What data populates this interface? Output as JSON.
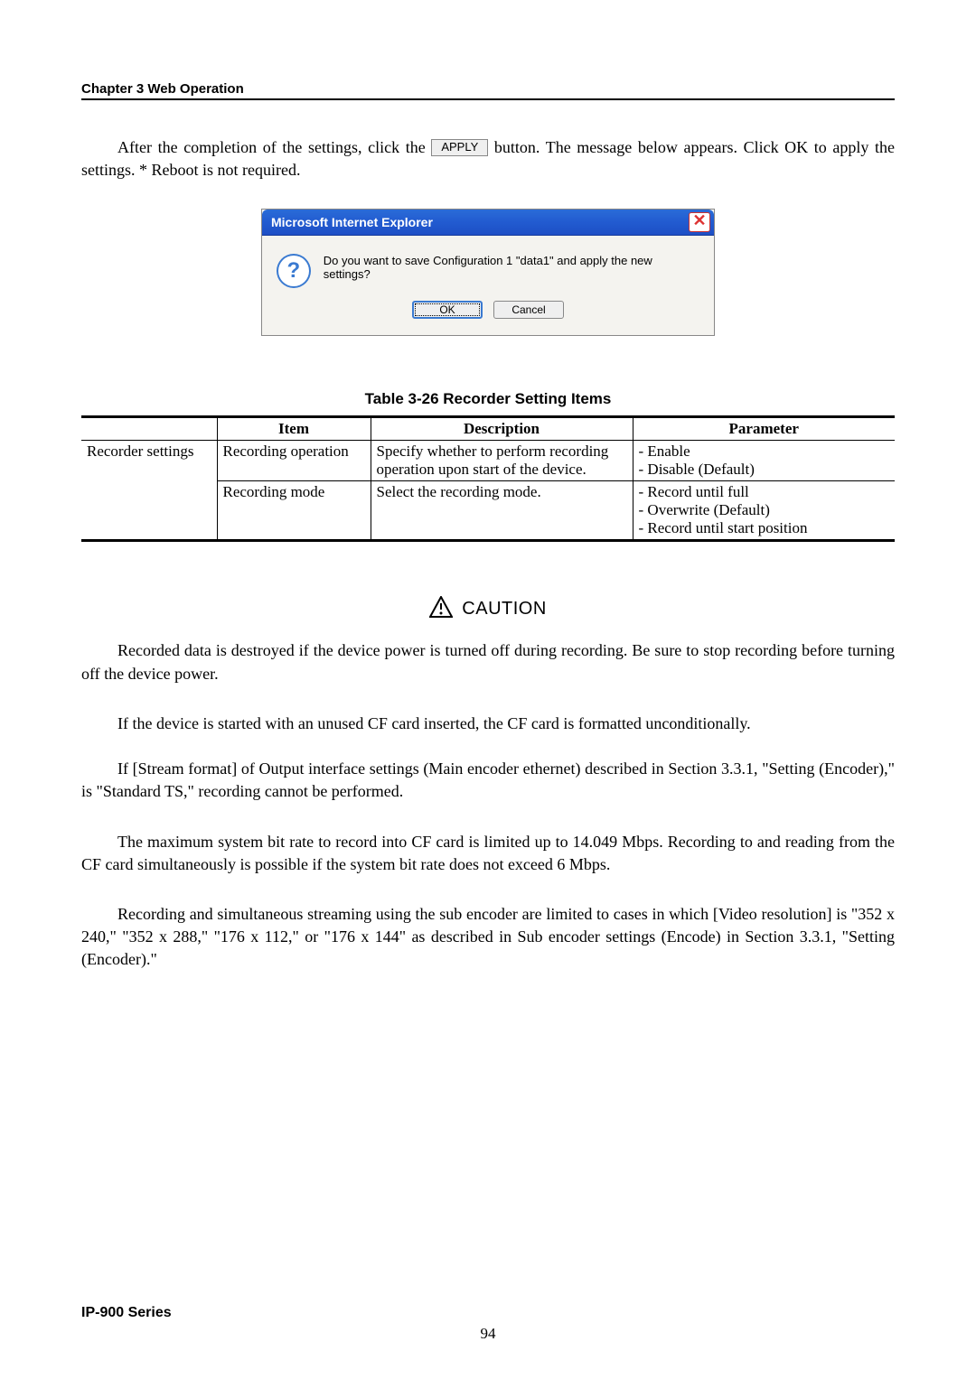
{
  "header": {
    "chapter": "Chapter 3  Web Operation"
  },
  "intro": {
    "before_btn": "After the completion of the settings, click the ",
    "apply_label": "APPLY",
    "after_btn": " button.  The message below appears.  Click OK to apply the settings. * Reboot is not required."
  },
  "dialog": {
    "title": "Microsoft Internet Explorer",
    "close_glyph": "✕",
    "question_glyph": "?",
    "message": "Do you want to save Configuration 1 \"data1\" and apply the new settings?",
    "ok": "OK",
    "cancel": "Cancel"
  },
  "table": {
    "caption": "Table 3-26  Recorder Setting Items",
    "headers": {
      "c1": "",
      "c2": "Item",
      "c3": "Description",
      "c4": "Parameter"
    },
    "group": "Recorder settings",
    "row1": {
      "item": "Recording operation",
      "desc": "Specify whether to perform recording operation upon start of the device.",
      "p1": "- Enable",
      "p2": "- Disable (Default)"
    },
    "row2": {
      "item": "Recording mode",
      "desc": "Select the recording mode.",
      "p1": "- Record until full",
      "p2": "- Overwrite (Default)",
      "p3": "- Record until start position"
    }
  },
  "caution": {
    "label": "CAUTION"
  },
  "body": {
    "p1": "Recorded data is destroyed if the device power is turned off during recording.  Be sure to stop recording before turning off the device power.",
    "p2": "If the device is started with an unused CF card inserted, the CF card is formatted unconditionally.",
    "p3": "If [Stream format] of Output interface settings (Main encoder ethernet) described in Section 3.3.1, \"Setting (Encoder),\" is \"Standard TS,\" recording cannot be performed.",
    "p4": "The maximum system bit rate to record into CF card is limited up to 14.049 Mbps.  Recording to and reading from the CF card simultaneously is possible if the system bit rate does not exceed 6 Mbps.",
    "p5": "Recording and simultaneous streaming using the sub encoder are limited to cases in which [Video resolution] is \"352 x 240,\" \"352 x 288,\" \"176 x 112,\" or \"176 x 144\" as described in Sub encoder settings (Encode) in Section 3.3.1, \"Setting (Encoder).\""
  },
  "footer": {
    "series": "IP-900 Series",
    "page": "94"
  }
}
